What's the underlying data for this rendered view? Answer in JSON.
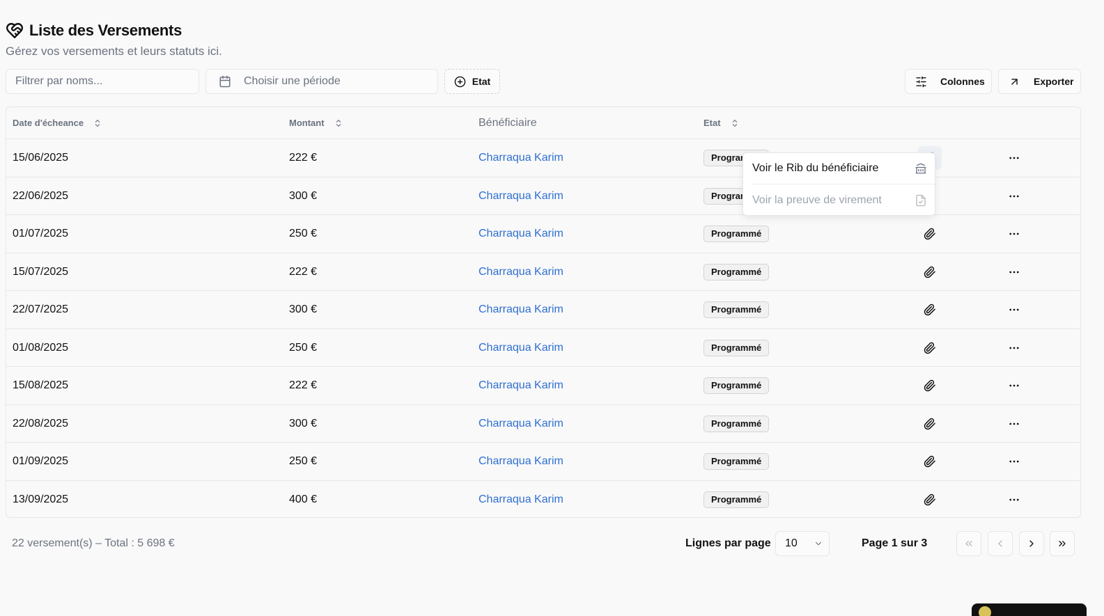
{
  "header": {
    "title": "Liste des Versements",
    "subtitle": "Gérez vos versements et leurs statuts ici.",
    "icon": "heart-handshake-icon"
  },
  "toolbar": {
    "filter_placeholder": "Filtrer par noms...",
    "period_placeholder": "Choisir une période",
    "etat_label": "Etat",
    "columns_label": "Colonnes",
    "export_label": "Exporter"
  },
  "table": {
    "columns": {
      "date": "Date d'écheance",
      "amount": "Montant",
      "beneficiary": "Bénéficiaire",
      "status": "Etat"
    },
    "rows": [
      {
        "date": "15/06/2025",
        "amount": "222 €",
        "beneficiary": "Charraqua Karim",
        "status": "Programmé"
      },
      {
        "date": "22/06/2025",
        "amount": "300 €",
        "beneficiary": "Charraqua Karim",
        "status": "Programmé"
      },
      {
        "date": "01/07/2025",
        "amount": "250 €",
        "beneficiary": "Charraqua Karim",
        "status": "Programmé"
      },
      {
        "date": "15/07/2025",
        "amount": "222 €",
        "beneficiary": "Charraqua Karim",
        "status": "Programmé"
      },
      {
        "date": "22/07/2025",
        "amount": "300 €",
        "beneficiary": "Charraqua Karim",
        "status": "Programmé"
      },
      {
        "date": "01/08/2025",
        "amount": "250 €",
        "beneficiary": "Charraqua Karim",
        "status": "Programmé"
      },
      {
        "date": "15/08/2025",
        "amount": "222 €",
        "beneficiary": "Charraqua Karim",
        "status": "Programmé"
      },
      {
        "date": "22/08/2025",
        "amount": "300 €",
        "beneficiary": "Charraqua Karim",
        "status": "Programmé"
      },
      {
        "date": "01/09/2025",
        "amount": "250 €",
        "beneficiary": "Charraqua Karim",
        "status": "Programmé"
      },
      {
        "date": "13/09/2025",
        "amount": "400 €",
        "beneficiary": "Charraqua Karim",
        "status": "Programmé"
      }
    ]
  },
  "dropdown": {
    "item_rib": "Voir le Rib du bénéficiaire",
    "item_proof": "Voir la preuve de virement"
  },
  "footer": {
    "count_text": "22 versement(s) – Total : 5 698 €",
    "rows_per_page_label": "Lignes par page",
    "rows_per_page_value": "10",
    "page_text": "Page 1 sur 3"
  },
  "colors": {
    "link": "#2f6fd1",
    "muted": "#6b7280",
    "border": "#e5e7eb",
    "background": "#f9f9f9"
  }
}
